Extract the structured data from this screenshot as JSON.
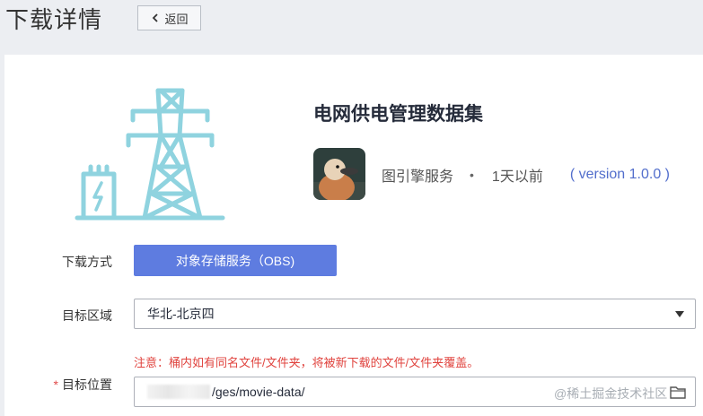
{
  "header": {
    "title": "下载详情",
    "back_label": "返回"
  },
  "dataset": {
    "name": "电网供电管理数据集",
    "service": "图引擎服务",
    "separator": "•",
    "time": "1天以前",
    "version": "( version 1.0.0 )"
  },
  "form": {
    "download_method_label": "下载方式",
    "download_method_value": "对象存储服务（OBS)",
    "region_label": "目标区域",
    "region_value": "华北-北京四",
    "notice": "注意：桶内如有同名文件/文件夹，将被新下载的文件/文件夹覆盖。",
    "required_mark": "*",
    "location_label": "目标位置",
    "location_value": "/ges/movie-data/"
  },
  "watermark": "@稀土掘金技术社区",
  "colors": {
    "accent": "#5e7ce0",
    "icon_teal": "#8fd3df",
    "notice_red": "#e0433e",
    "version_blue": "#526ecc"
  },
  "icons": [
    "chevron-left-icon",
    "power-tower-icon",
    "duck-avatar",
    "caret-down-icon",
    "folder-icon"
  ]
}
